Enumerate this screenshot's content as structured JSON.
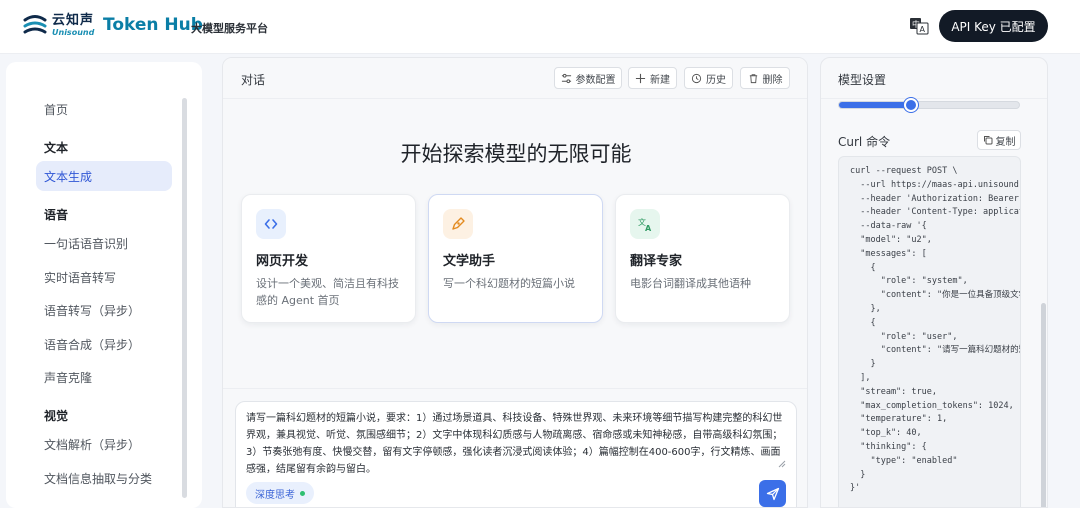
{
  "header": {
    "logo_cn": "云知声",
    "logo_en": "Unisound",
    "brand": "Token Hub",
    "brand_sub": "大模型服务平台",
    "api_button": "API Key 已配置"
  },
  "sidebar": {
    "items": [
      {
        "label": "首页",
        "kind": "item"
      },
      {
        "label": "文本",
        "kind": "section"
      },
      {
        "label": "文本生成",
        "kind": "item",
        "active": true
      },
      {
        "label": "语音",
        "kind": "section"
      },
      {
        "label": "一句话语音识别",
        "kind": "item"
      },
      {
        "label": "实时语音转写",
        "kind": "item"
      },
      {
        "label": "语音转写（异步）",
        "kind": "item"
      },
      {
        "label": "语音合成（异步）",
        "kind": "item"
      },
      {
        "label": "声音克隆",
        "kind": "item"
      },
      {
        "label": "视觉",
        "kind": "section"
      },
      {
        "label": "文档解析（异步）",
        "kind": "item"
      },
      {
        "label": "文档信息抽取与分类",
        "kind": "item"
      }
    ]
  },
  "chat": {
    "title": "对话",
    "toolbar": {
      "params": "参数配置",
      "new": "新建",
      "history": "历史",
      "delete": "删除"
    },
    "hero": "开始探索模型的无限可能",
    "cards": [
      {
        "icon": "code-icon",
        "title": "网页开发",
        "desc": "设计一个美观、简洁且有科技感的 Agent 首页",
        "icon_bg": "#e8f0fd",
        "icon_color": "#3b6fe8"
      },
      {
        "icon": "pen-icon",
        "title": "文学助手",
        "desc": "写一个科幻题材的短篇小说",
        "icon_bg": "#fdf1e3",
        "icon_color": "#e38a1f"
      },
      {
        "icon": "translate-icon",
        "title": "翻译专家",
        "desc": "电影台词翻译成其他语种",
        "icon_bg": "#e6f6ee",
        "icon_color": "#2f9a62"
      }
    ],
    "input": {
      "text": "请写一篇科幻题材的短篇小说，要求：1）通过场景道具、科技设备、特殊世界观、未来环境等细节描写构建完整的科幻世界观，兼具视觉、听觉、氛围感细节；2）文字中体现科幻质感与人物疏离感、宿命感或未知神秘感，自带高级科幻氛围；3）节奏张弛有度、快慢交替，留有文字停顿感，强化读者沉浸式阅读体验；4）篇幅控制在400-600字，行文精炼、画面感强，结尾留有余韵与留白。",
      "deep_think": "深度思考"
    }
  },
  "settings": {
    "title": "模型设置",
    "slider_value": 0.4,
    "curl_label": "Curl 命令",
    "copy": "复制",
    "code": "curl --request POST \\\n  --url https://maas-api.unisound.\n  --header 'Authorization: Bearer \n  --header 'Content-Type: applicat\n  --data-raw '{\n  \"model\": \"u2\",\n  \"messages\": [\n    {\n      \"role\": \"system\",\n      \"content\": \"你是一位具备顶级文学\n    },\n    {\n      \"role\": \"user\",\n      \"content\": \"请写一篇科幻题材的短\n    }\n  ],\n  \"stream\": true,\n  \"max_completion_tokens\": 1024,\n  \"temperature\": 1,\n  \"top_k\": 40,\n  \"thinking\": {\n    \"type\": \"enabled\"\n  }\n}'"
  }
}
